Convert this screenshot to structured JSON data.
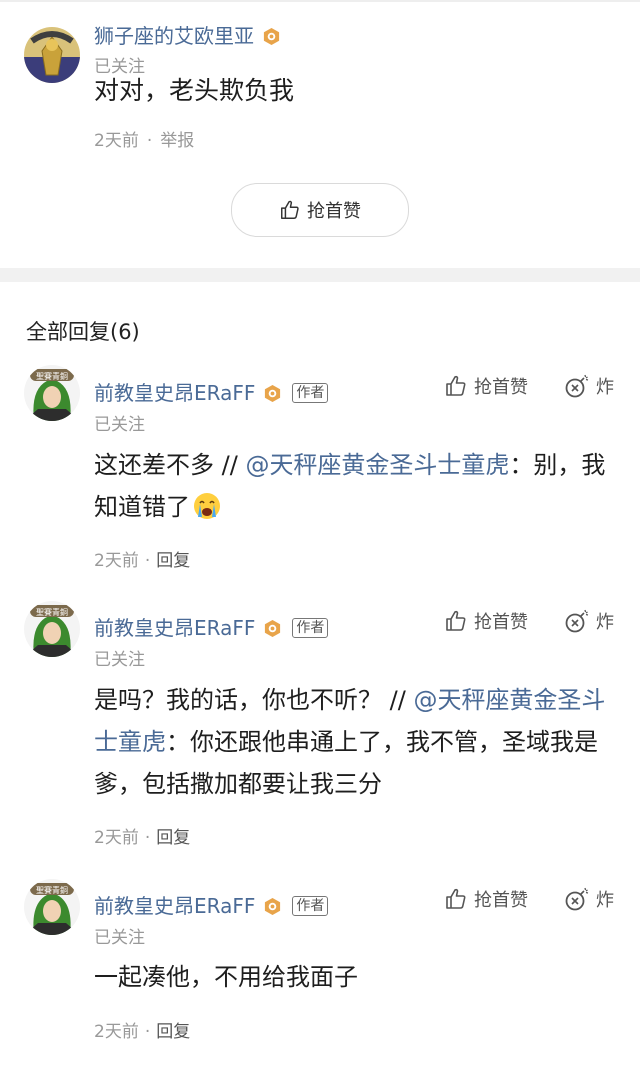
{
  "main_comment": {
    "username": "狮子座的艾欧里亚",
    "follow_status": "已关注",
    "text": "对对，老头欺负我",
    "time": "2天前",
    "dot": "·",
    "report_label": "举报",
    "like_button_label": "抢首赞"
  },
  "replies_header": "全部回复(6)",
  "replies": [
    {
      "username": "前教皇史昂ERaFF",
      "author_tag": "作者",
      "follow_status": "已关注",
      "like_label": "抢首赞",
      "bomb_label": "炸",
      "text_main": "这还差不多 // ",
      "mention": "@天秤座黄金圣斗士童虎",
      "text_after": "：别，我知道错了",
      "emoji": "crying-face-emoji",
      "time": "2天前",
      "dot": "·",
      "reply_label": "回复"
    },
    {
      "username": "前教皇史昂ERaFF",
      "author_tag": "作者",
      "follow_status": "已关注",
      "like_label": "抢首赞",
      "bomb_label": "炸",
      "text_main": "是吗？我的话，你也不听？ // ",
      "mention": "@天秤座黄金圣斗士童虎",
      "text_after": "：你还跟他串通上了，我不管，圣域我是爹，包括撒加都要让我三分",
      "time": "2天前",
      "dot": "·",
      "reply_label": "回复"
    },
    {
      "username": "前教皇史昂ERaFF",
      "author_tag": "作者",
      "follow_status": "已关注",
      "like_label": "抢首赞",
      "bomb_label": "炸",
      "text_main": "一起凑他，不用给我面子",
      "time": "2天前",
      "dot": "·",
      "reply_label": "回复"
    }
  ],
  "avatar_badge_text": "聖賽青銅",
  "colors": {
    "username": "#4a6a96",
    "mention": "#4a6a96",
    "level_badge": "#e8a44a",
    "separator": "#f1f1f1"
  }
}
